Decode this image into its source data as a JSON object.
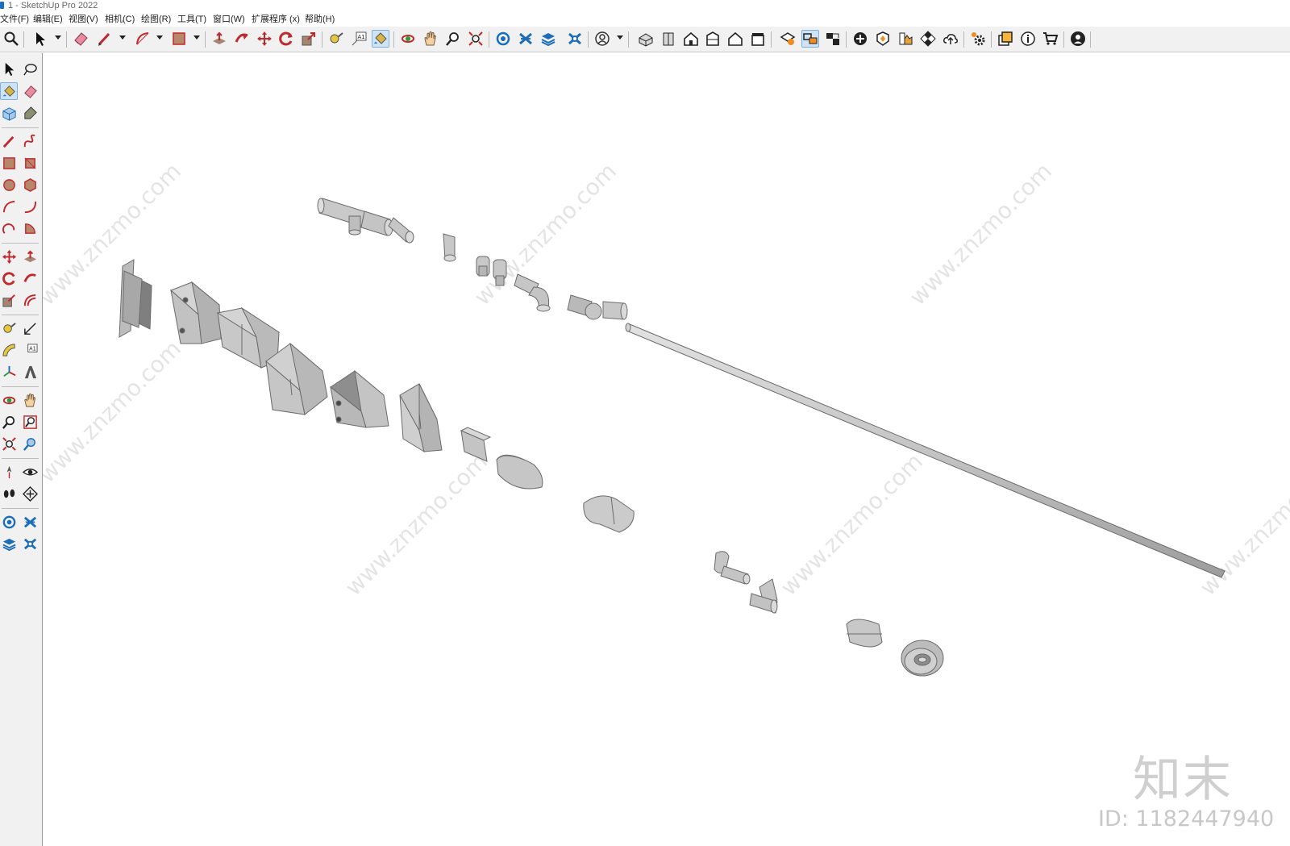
{
  "window": {
    "title": "1 - SketchUp Pro 2022"
  },
  "menu": [
    "文件(F)",
    "编辑(E)",
    "视图(V)",
    "相机(C)",
    "绘图(R)",
    "工具(T)",
    "窗口(W)",
    "扩展程序 (x)",
    "帮助(H)"
  ],
  "watermark": {
    "brand": "知末",
    "id": "ID: 1182447940",
    "url": "www.znzmo.com",
    "chars": "知末网"
  },
  "colors": {
    "toolbar_bg": "#f1f1f1",
    "accent": "#1a6fc4",
    "model_fill": "#c8c8c8",
    "model_stroke": "#707070"
  }
}
